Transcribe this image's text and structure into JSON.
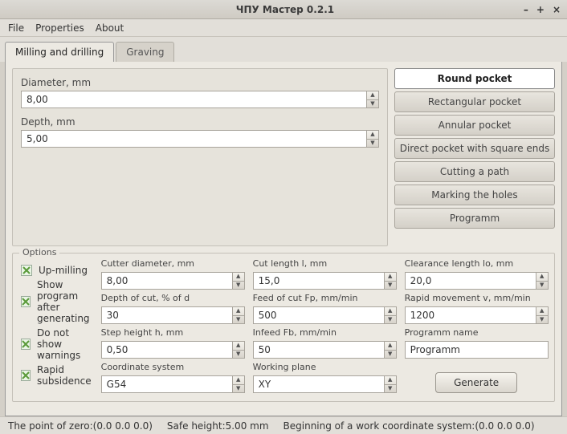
{
  "window": {
    "title": "ЧПУ Мастер 0.2.1"
  },
  "menubar": {
    "file": "File",
    "properties": "Properties",
    "about": "About"
  },
  "tabs": {
    "milling": "Milling and drilling",
    "graving": "Graving"
  },
  "left": {
    "diameter_label": "Diameter, mm",
    "diameter_value": "8,00",
    "depth_label": "Depth, mm",
    "depth_value": "5,00"
  },
  "ops": {
    "round": "Round pocket",
    "rect": "Rectangular pocket",
    "annular": "Annular pocket",
    "direct": "Direct pocket with square ends",
    "path": "Cutting a path",
    "holes": "Marking the holes",
    "prog": "Programm"
  },
  "options": {
    "legend": "Options",
    "up_milling": "Up-milling",
    "show_prog": "Show program after generating",
    "no_warn": "Do not show warnings",
    "rapid_sub": "Rapid subsidence"
  },
  "params": {
    "cutter_d_label": "Cutter diameter, mm",
    "cutter_d": "8,00",
    "depth_cut_label": "Depth of cut, % of d",
    "depth_cut": "30",
    "step_h_label": "Step height h, mm",
    "step_h": "0,50",
    "coord_label": "Coordinate system",
    "coord": "G54",
    "cut_len_label": "Cut length l, mm",
    "cut_len": "15,0",
    "feed_fp_label": "Feed of cut Fp, mm/min",
    "feed_fp": "500",
    "infeed_label": "Infeed Fb, mm/min",
    "infeed": "50",
    "plane_label": "Working plane",
    "plane": "XY",
    "clear_label": "Clearance length lo, mm",
    "clear": "20,0",
    "rapid_v_label": "Rapid movement v, mm/min",
    "rapid_v": "1200",
    "prog_name_label": "Programm name",
    "prog_name": "Programm",
    "generate": "Generate"
  },
  "status": {
    "zero": "The point of zero:(0.0  0.0  0.0)",
    "safe": "Safe height:5.00 mm",
    "origin": "Beginning of a work coordinate system:(0.0  0.0  0.0)"
  }
}
